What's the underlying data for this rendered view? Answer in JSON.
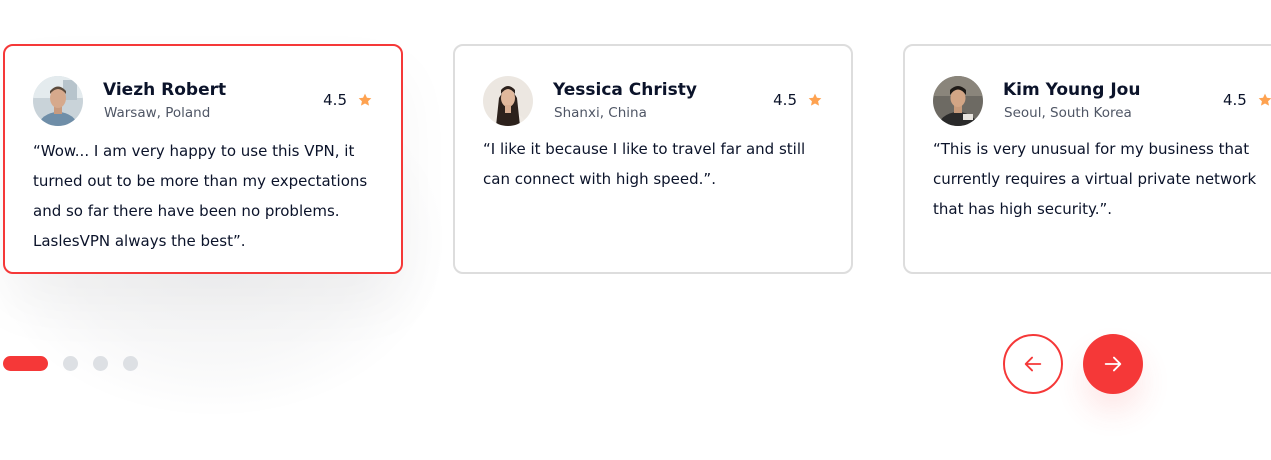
{
  "testimonials": [
    {
      "name": "Viezh Robert",
      "location": "Warsaw, Poland",
      "rating": "4.5",
      "quote": "“Wow... I am very happy to use this VPN, it turned out to be more than my expectations and so far there have been no problems. LaslesVPN always the best”.",
      "active": true
    },
    {
      "name": "Yessica Christy",
      "location": "Shanxi, China",
      "rating": "4.5",
      "quote": "“I like it because I like to travel far and still can connect with high speed.”.",
      "active": false
    },
    {
      "name": "Kim Young Jou",
      "location": "Seoul, South Korea",
      "rating": "4.5",
      "quote": "“This is very unusual for my business that currently requires a virtual private network that has high security.”.",
      "active": false
    }
  ],
  "pagination": {
    "count": 4,
    "active_index": 0
  },
  "navigation": {
    "prev_icon": "arrow-left-icon",
    "next_icon": "arrow-right-icon"
  },
  "colors": {
    "accent": "#F53838",
    "star": "#FEA250",
    "text_primary": "#0B132A",
    "text_secondary": "#4F5665",
    "card_border": "#DDDDDD",
    "dot_inactive": "#DDE0E4"
  }
}
